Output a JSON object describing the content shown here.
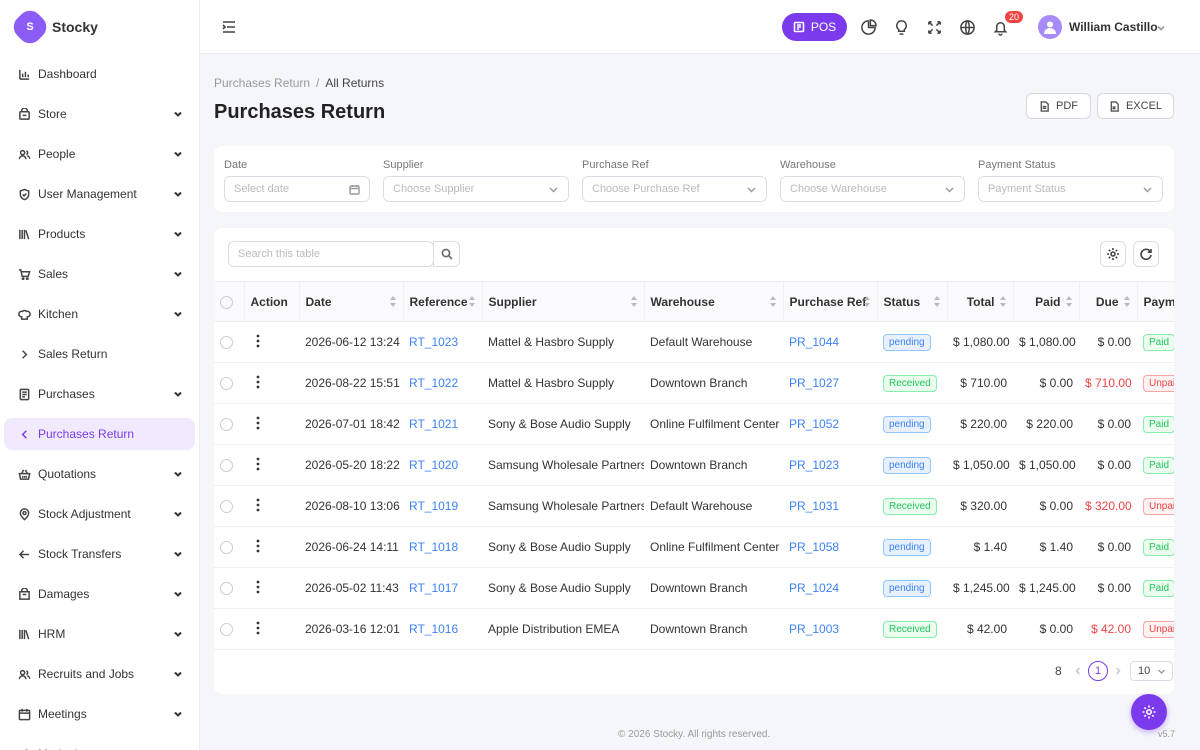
{
  "app": {
    "name": "Stocky",
    "logo_letter": "S"
  },
  "sidebar": {
    "items": [
      {
        "label": "Dashboard",
        "icon": "bar-chart-icon",
        "expandable": false
      },
      {
        "label": "Store",
        "icon": "store-icon",
        "expandable": true
      },
      {
        "label": "People",
        "icon": "users-icon",
        "expandable": true
      },
      {
        "label": "User Management",
        "icon": "shield-icon",
        "expandable": true
      },
      {
        "label": "Products",
        "icon": "books-icon",
        "expandable": true
      },
      {
        "label": "Sales",
        "icon": "cart-icon",
        "expandable": true
      },
      {
        "label": "Kitchen",
        "icon": "chef-hat-icon",
        "expandable": true
      },
      {
        "label": "Sales Return",
        "icon": "chevron-right-icon",
        "expandable": false
      },
      {
        "label": "Purchases",
        "icon": "receipt-icon",
        "expandable": true
      },
      {
        "label": "Purchases Return",
        "icon": "chevron-left-icon",
        "expandable": false,
        "active": true
      },
      {
        "label": "Quotations",
        "icon": "basket-icon",
        "expandable": true
      },
      {
        "label": "Stock Adjustment",
        "icon": "target-icon",
        "expandable": true
      },
      {
        "label": "Stock Transfers",
        "icon": "arrow-left-icon",
        "expandable": true
      },
      {
        "label": "Damages",
        "icon": "box-icon",
        "expandable": true
      },
      {
        "label": "HRM",
        "icon": "library-icon",
        "expandable": true
      },
      {
        "label": "Recruits and Jobs",
        "icon": "users-icon",
        "expandable": true
      },
      {
        "label": "Meetings",
        "icon": "calendar-icon",
        "expandable": true
      },
      {
        "label": "Marketing",
        "icon": "megaphone-icon",
        "expandable": true
      }
    ]
  },
  "header": {
    "pos_label": "POS",
    "notification_count": "20",
    "user_name": "William Castillo"
  },
  "breadcrumb": {
    "parent": "Purchases Return",
    "separator": "/",
    "current": "All Returns"
  },
  "page": {
    "title": "Purchases Return",
    "pdf_label": "PDF",
    "excel_label": "EXCEL"
  },
  "filters": {
    "date": {
      "label": "Date",
      "placeholder": "Select date"
    },
    "supplier": {
      "label": "Supplier",
      "placeholder": "Choose Supplier"
    },
    "purchase_ref": {
      "label": "Purchase Ref",
      "placeholder": "Choose Purchase Ref"
    },
    "warehouse": {
      "label": "Warehouse",
      "placeholder": "Choose Warehouse"
    },
    "payment_status": {
      "label": "Payment Status",
      "placeholder": "Payment Status"
    }
  },
  "table": {
    "search_placeholder": "Search this table",
    "columns": [
      "Action",
      "Date",
      "Reference",
      "Supplier",
      "Warehouse",
      "Purchase Ref",
      "Status",
      "Total",
      "Paid",
      "Due",
      "Payment"
    ],
    "rows": [
      {
        "date": "2026-06-12 13:24",
        "reference": "RT_1023",
        "supplier": "Mattel & Hasbro Supply",
        "warehouse": "Default Warehouse",
        "purchase_ref": "PR_1044",
        "status": "pending",
        "total": "$ 1,080.00",
        "paid": "$ 1,080.00",
        "due": "$ 0.00",
        "payment": "Paid"
      },
      {
        "date": "2026-08-22 15:51",
        "reference": "RT_1022",
        "supplier": "Mattel & Hasbro Supply",
        "warehouse": "Downtown Branch",
        "purchase_ref": "PR_1027",
        "status": "Received",
        "total": "$ 710.00",
        "paid": "$ 0.00",
        "due": "$ 710.00",
        "payment": "Unpaid"
      },
      {
        "date": "2026-07-01 18:42",
        "reference": "RT_1021",
        "supplier": "Sony & Bose Audio Supply",
        "warehouse": "Online Fulfilment Center",
        "purchase_ref": "PR_1052",
        "status": "pending",
        "total": "$ 220.00",
        "paid": "$ 220.00",
        "due": "$ 0.00",
        "payment": "Paid"
      },
      {
        "date": "2026-05-20 18:22",
        "reference": "RT_1020",
        "supplier": "Samsung Wholesale Partners",
        "warehouse": "Downtown Branch",
        "purchase_ref": "PR_1023",
        "status": "pending",
        "total": "$ 1,050.00",
        "paid": "$ 1,050.00",
        "due": "$ 0.00",
        "payment": "Paid"
      },
      {
        "date": "2026-08-10 13:06",
        "reference": "RT_1019",
        "supplier": "Samsung Wholesale Partners",
        "warehouse": "Default Warehouse",
        "purchase_ref": "PR_1031",
        "status": "Received",
        "total": "$ 320.00",
        "paid": "$ 0.00",
        "due": "$ 320.00",
        "payment": "Unpaid"
      },
      {
        "date": "2026-06-24 14:11",
        "reference": "RT_1018",
        "supplier": "Sony & Bose Audio Supply",
        "warehouse": "Online Fulfilment Center",
        "purchase_ref": "PR_1058",
        "status": "pending",
        "total": "$ 1.40",
        "paid": "$ 1.40",
        "due": "$ 0.00",
        "payment": "Paid"
      },
      {
        "date": "2026-05-02 11:43",
        "reference": "RT_1017",
        "supplier": "Sony & Bose Audio Supply",
        "warehouse": "Downtown Branch",
        "purchase_ref": "PR_1024",
        "status": "pending",
        "total": "$ 1,245.00",
        "paid": "$ 1,245.00",
        "due": "$ 0.00",
        "payment": "Paid"
      },
      {
        "date": "2026-03-16 12:01",
        "reference": "RT_1016",
        "supplier": "Apple Distribution EMEA",
        "warehouse": "Downtown Branch",
        "purchase_ref": "PR_1003",
        "status": "Received",
        "total": "$ 42.00",
        "paid": "$ 0.00",
        "due": "$ 42.00",
        "payment": "Unpaid"
      }
    ]
  },
  "pagination": {
    "total": "8",
    "current_page": "1",
    "page_size": "10"
  },
  "footer": {
    "text": "© 2026 Stocky. All rights reserved.",
    "version": "v5.7"
  },
  "colors": {
    "accent": "#7c3aed",
    "link": "#3b82f6",
    "danger": "#ef4444",
    "success": "#22c55e"
  }
}
